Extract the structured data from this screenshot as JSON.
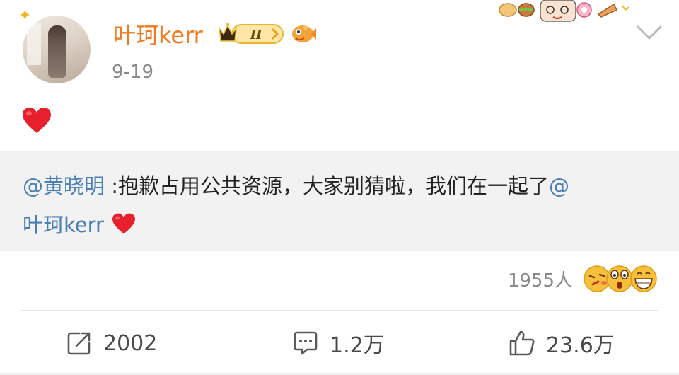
{
  "post": {
    "author": "叶珂kerr",
    "vip_level": "II",
    "date": "9-19",
    "content_emoji": "red-heart"
  },
  "repost": {
    "mention_author": "@黄晓明",
    "text": " :抱歉占用公共资源，大家别猜啦，我们在一起了",
    "mention_target_at": "@",
    "mention_target": "叶珂kerr",
    "trailing_emoji": "red-heart"
  },
  "reactions": {
    "count_label": "1955人",
    "emojis": [
      "face-blowing-kiss",
      "astonished-face",
      "grinning-squinting-face"
    ]
  },
  "actions": {
    "repost": "2002",
    "comment": "1.2万",
    "like": "23.6万"
  },
  "colors": {
    "username": "#f07a1e",
    "mention": "#4a7fb3",
    "heart": "#e8202e",
    "repost_bg": "#f2f2f2"
  }
}
